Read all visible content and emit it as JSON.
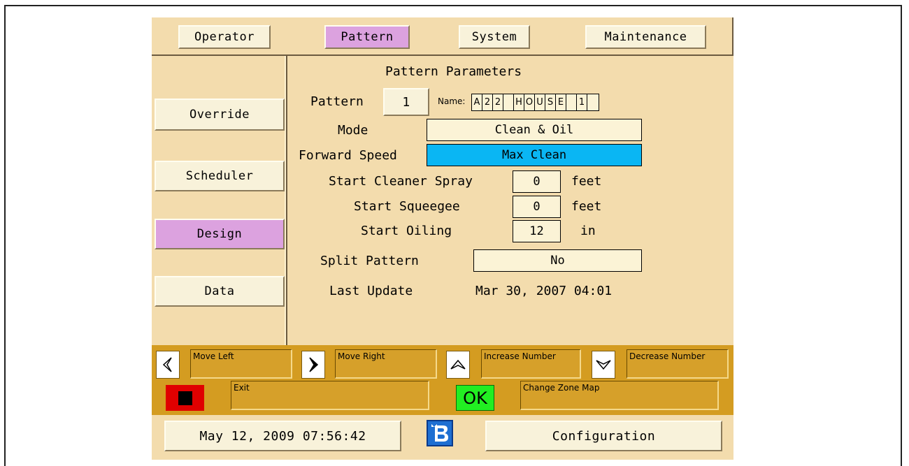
{
  "top_tabs": [
    {
      "label": "Operator",
      "active": false
    },
    {
      "label": "Pattern",
      "active": true
    },
    {
      "label": "System",
      "active": false
    },
    {
      "label": "Maintenance",
      "active": false
    }
  ],
  "side_buttons": [
    {
      "label": "Override",
      "active": false
    },
    {
      "label": "Scheduler",
      "active": false
    },
    {
      "label": "Design",
      "active": true
    },
    {
      "label": "Data",
      "active": false
    }
  ],
  "panel": {
    "title": "Pattern Parameters",
    "pattern_label": "Pattern",
    "pattern_number": "1",
    "name_label": "Name:",
    "name_chars": [
      "A",
      "2",
      "2",
      " ",
      "H",
      "O",
      "U",
      "S",
      "E",
      " ",
      "1",
      " "
    ],
    "mode_label": "Mode",
    "mode_value": "Clean & Oil",
    "forward_speed_label": "Forward Speed",
    "forward_speed_value": "Max Clean",
    "start_cleaner_label": "Start Cleaner Spray",
    "start_cleaner_value": "0",
    "start_cleaner_unit": "feet",
    "start_squeegee_label": "Start Squeegee",
    "start_squeegee_value": "0",
    "start_squeegee_unit": "feet",
    "start_oiling_label": "Start Oiling",
    "start_oiling_value": "12",
    "start_oiling_unit": "in",
    "split_label": "Split Pattern",
    "split_value": "No",
    "last_update_label": "Last Update",
    "last_update_value": "Mar 30, 2007 04:01"
  },
  "keys": {
    "move_left": "Move Left",
    "move_right": "Move Right",
    "increase": "Increase Number",
    "decrease": "Decrease Number",
    "exit": "Exit",
    "ok": "OK",
    "change_zone": "Change Zone Map"
  },
  "footer": {
    "datetime": "May 12, 2009 07:56:42",
    "configuration": "Configuration"
  },
  "colors": {
    "background": "#f3dcad",
    "active_tab": "#dca2df",
    "highlight_field": "#0ab6f3",
    "key_panel": "#d49c21",
    "exit_red": "#e00000",
    "ok_green": "#22ee22"
  }
}
